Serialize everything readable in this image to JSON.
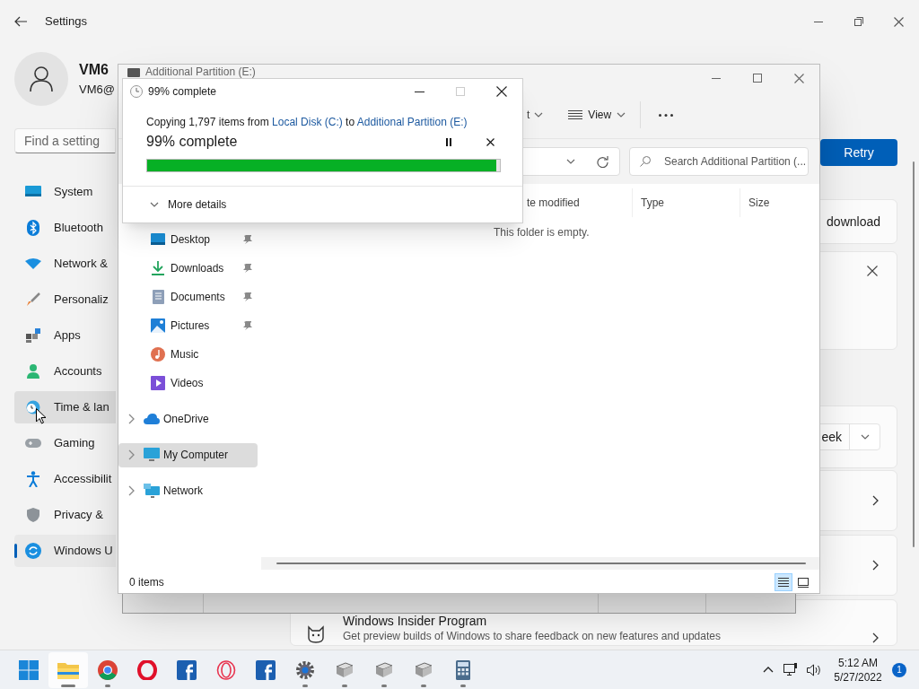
{
  "settings": {
    "title": "Settings",
    "user": {
      "name": "VM6",
      "email": "VM6@"
    },
    "search": {
      "placeholder": "Find a setting"
    },
    "nav": [
      {
        "label": "System",
        "selected": false,
        "hovered": false
      },
      {
        "label": "Bluetooth",
        "selected": false,
        "hovered": false
      },
      {
        "label": "Network &",
        "selected": false,
        "hovered": false
      },
      {
        "label": "Personaliz",
        "selected": false,
        "hovered": false
      },
      {
        "label": "Apps",
        "selected": false,
        "hovered": false
      },
      {
        "label": "Accounts",
        "selected": false,
        "hovered": false
      },
      {
        "label": "Time & lan",
        "selected": false,
        "hovered": true
      },
      {
        "label": "Gaming",
        "selected": false,
        "hovered": false
      },
      {
        "label": "Accessibilit",
        "selected": false,
        "hovered": false
      },
      {
        "label": "Privacy &",
        "selected": false,
        "hovered": false
      },
      {
        "label": "Windows U",
        "selected": true,
        "hovered": false
      }
    ],
    "retry": "Retry",
    "cards": [
      {
        "kind": "text",
        "text": "download"
      },
      {
        "kind": "dismiss"
      },
      {
        "kind": "dropdown",
        "value": "eek"
      },
      {
        "kind": "link"
      },
      {
        "kind": "link"
      },
      {
        "kind": "program",
        "title": "Windows Insider Program",
        "subtitle": "Get preview builds of Windows to share feedback on new features and updates"
      }
    ]
  },
  "explorer": {
    "title": "Additional Partition (E:)",
    "sort_label": "t",
    "view_label": "View",
    "search": {
      "placeholder": "Search Additional Partition (..."
    },
    "columns": [
      "te modified",
      "Type",
      "Size"
    ],
    "empty_text": "This folder is empty.",
    "quick_access": [
      {
        "label": "Desktop",
        "pinned": true
      },
      {
        "label": "Downloads",
        "pinned": true
      },
      {
        "label": "Documents",
        "pinned": true
      },
      {
        "label": "Pictures",
        "pinned": true
      },
      {
        "label": "Music",
        "pinned": false
      },
      {
        "label": "Videos",
        "pinned": false
      }
    ],
    "roots": [
      {
        "label": "OneDrive",
        "expanded": false,
        "selected": false
      },
      {
        "label": "My Computer",
        "expanded": false,
        "selected": true
      },
      {
        "label": "Network",
        "expanded": false,
        "selected": false
      }
    ],
    "status": "0 items",
    "view_modes": [
      {
        "selected": true
      },
      {
        "selected": false
      }
    ]
  },
  "dialog": {
    "title": "99% complete",
    "copy": {
      "prefix": "Copying 1,797 items from",
      "source": "Local Disk (C:)",
      "middle": "to",
      "destination": "Additional Partition (E:)"
    },
    "status": "99% complete",
    "level": 0.99,
    "details": "More details"
  },
  "taskbar": {
    "apps": [
      {
        "running": true,
        "active": true
      },
      {
        "running": true,
        "active": false
      },
      {
        "running": false,
        "active": false
      },
      {
        "running": false,
        "active": false
      },
      {
        "running": false,
        "active": false
      },
      {
        "running": false,
        "active": false
      },
      {
        "running": true,
        "active": false
      },
      {
        "running": true,
        "active": false
      },
      {
        "running": true,
        "active": false
      },
      {
        "running": true,
        "active": false
      },
      {
        "running": true,
        "active": false
      }
    ],
    "time": "5:12 AM",
    "date": "5/27/2022",
    "notifications": "1"
  }
}
